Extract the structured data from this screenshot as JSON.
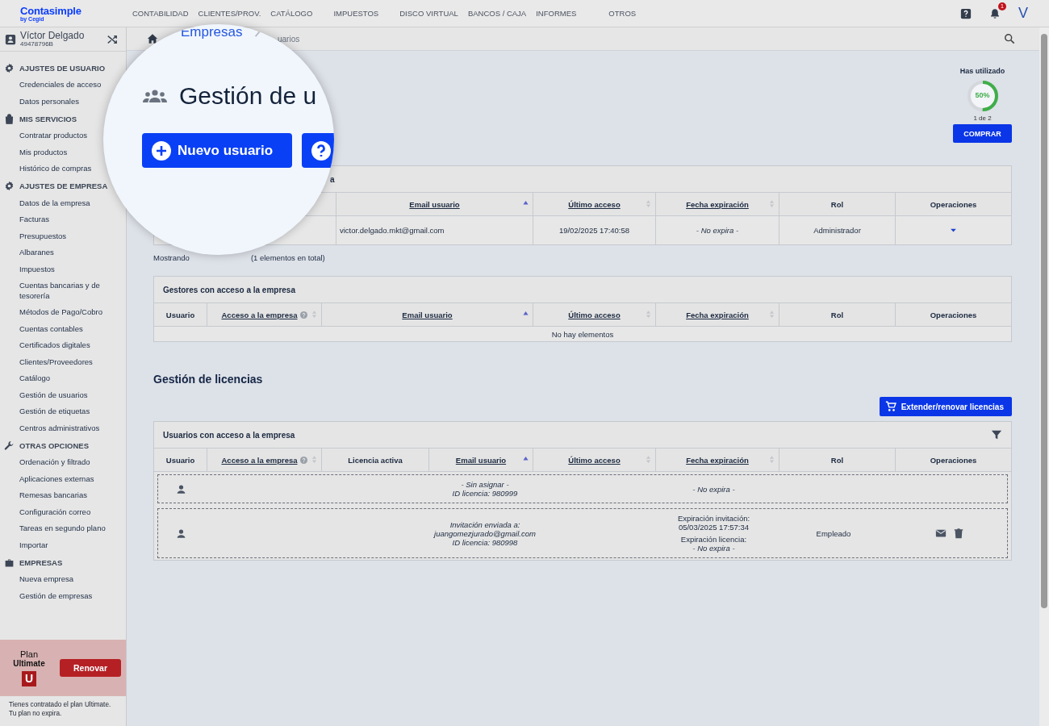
{
  "brand": {
    "name": "Contasimple",
    "sub": "by Cegid"
  },
  "nav": [
    "CONTABILIDAD",
    "CLIENTES/PROV.",
    "CATÁLOGO",
    "IMPUESTOS",
    "DISCO VIRTUAL",
    "BANCOS / CAJA",
    "INFORMES",
    "OTROS"
  ],
  "notifications": {
    "count": "1"
  },
  "avatar": "V",
  "account": {
    "name": "Víctor Delgado",
    "id": "49478796B"
  },
  "sidebar": {
    "sections": [
      {
        "title": "AJUSTES DE USUARIO",
        "items": [
          "Credenciales de acceso",
          "Datos personales"
        ]
      },
      {
        "title": "MIS SERVICIOS",
        "items": [
          "Contratar productos",
          "Mis productos",
          "Histórico de compras"
        ]
      },
      {
        "title": "AJUSTES DE EMPRESA",
        "items": [
          "Datos de la empresa",
          "Facturas",
          "Presupuestos",
          "Albaranes",
          "Impuestos",
          "Cuentas bancarias y de tesorería",
          "Métodos de Pago/Cobro",
          "Cuentas contables",
          "Certificados digitales",
          "Clientes/Proveedores",
          "Catálogo",
          "Gestión de usuarios",
          "Gestión de etiquetas",
          "Centros administrativos"
        ]
      },
      {
        "title": "OTRAS OPCIONES",
        "items": [
          "Ordenación y filtrado",
          "Aplicaciones externas",
          "Remesas bancarias",
          "Configuración correo",
          "Tareas en segundo plano",
          "Importar"
        ]
      },
      {
        "title": "EMPRESAS",
        "items": [
          "Nueva empresa",
          "Gestión de empresas"
        ]
      }
    ]
  },
  "plan": {
    "label": "Plan",
    "name": "Ultimate",
    "badge": "U",
    "button": "Renovar",
    "note": [
      "Tienes contratado el plan Ultimate.",
      "Tu plan no expira."
    ]
  },
  "breadcrumb": {
    "tail": "uarios"
  },
  "magnifier": {
    "breadcrumb": "Empresas",
    "title": "Gestión de u",
    "new_button": "Nuevo usuario"
  },
  "usage": {
    "label": "Has utilizado",
    "level": 0.5,
    "reading": "50%",
    "count": "1 de 2",
    "button": "COMPRAR"
  },
  "users_table": {
    "title": "a",
    "columns": [
      {
        "label": "Email usuario",
        "sortable": true,
        "sorted": true
      },
      {
        "label": "Último acceso",
        "sortable": true,
        "sorted": false
      },
      {
        "label": "Fecha expiración",
        "sortable": true,
        "sorted": false
      },
      {
        "label": "Rol",
        "sortable": false,
        "sorted": false
      },
      {
        "label": "Operaciones",
        "sortable": false,
        "sorted": false
      }
    ],
    "rows": [
      {
        "email": "victor.delgado.mkt@gmail.com",
        "last_access": "19/02/2025 17:40:58",
        "expiry": "- No expira -",
        "role": "Administrador"
      }
    ],
    "footer": [
      "Mostrando",
      "(1 elementos en total)"
    ]
  },
  "managers_table": {
    "title": "Gestores con acceso a la empresa",
    "columns": [
      {
        "label": "Usuario",
        "sortable": false,
        "sorted": false
      },
      {
        "label": "Acceso a la empresa",
        "sortable": true,
        "sorted": false,
        "help": true
      },
      {
        "label": "Email usuario",
        "sortable": true,
        "sorted": true
      },
      {
        "label": "Último acceso",
        "sortable": true,
        "sorted": false
      },
      {
        "label": "Fecha expiración",
        "sortable": true,
        "sorted": false
      },
      {
        "label": "Rol",
        "sortable": false,
        "sorted": false
      },
      {
        "label": "Operaciones",
        "sortable": false,
        "sorted": false
      }
    ],
    "empty": "No hay elementos"
  },
  "licenses": {
    "heading": "Gestión de licencias",
    "button": "Extender/renovar licencias",
    "table": {
      "title": "Usuarios con acceso a la empresa",
      "columns": [
        {
          "label": "Usuario",
          "sortable": false,
          "sorted": false
        },
        {
          "label": "Acceso a la empresa",
          "sortable": true,
          "sorted": false,
          "help": true
        },
        {
          "label": "Licencia activa",
          "sortable": false,
          "sorted": false
        },
        {
          "label": "Email usuario",
          "sortable": true,
          "sorted": true
        },
        {
          "label": "Último acceso",
          "sortable": true,
          "sorted": false
        },
        {
          "label": "Fecha expiración",
          "sortable": true,
          "sorted": false
        },
        {
          "label": "Rol",
          "sortable": false,
          "sorted": false
        },
        {
          "label": "Operaciones",
          "sortable": false,
          "sorted": false
        }
      ],
      "rows": [
        {
          "info": [
            "- Sin asignar -",
            "ID licencia: 980999"
          ],
          "expiry": [
            {
              "text": "- No expira -",
              "italic": true
            }
          ],
          "actions": []
        },
        {
          "info": [
            "Invitación enviada a:",
            "juangomezjurado@gmail.com",
            "ID licencia: 980998"
          ],
          "expiry": [
            {
              "text": "Expiración invitación:",
              "italic": false
            },
            {
              "text": "05/03/2025 17:57:34",
              "italic": false
            },
            {
              "text": "Expiración licencia:",
              "italic": false
            },
            {
              "text": "- No expira -",
              "italic": true
            }
          ],
          "role": "Empleado",
          "actions": [
            {
              "kind": "mail"
            },
            {
              "kind": "trash"
            }
          ]
        }
      ]
    }
  }
}
